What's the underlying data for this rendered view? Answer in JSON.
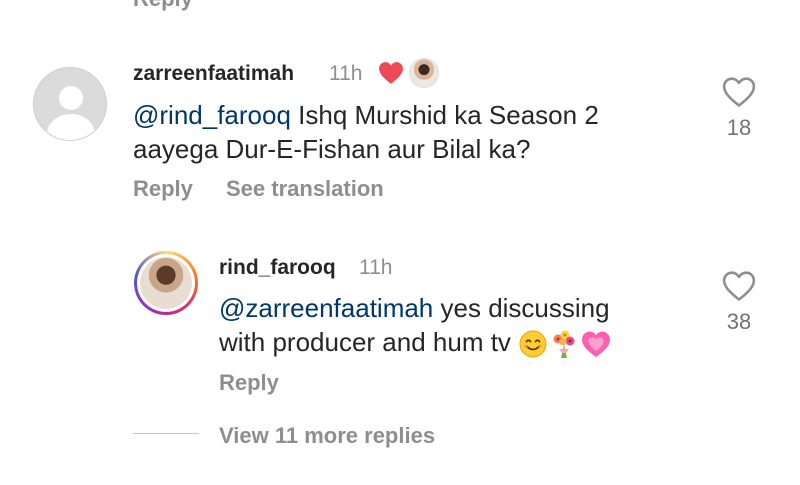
{
  "previous": {
    "reply_label": "Reply"
  },
  "comment": {
    "username": "zarreenfaatimah",
    "time": "11h",
    "mention": "@rind_farooq",
    "text_line1": " Ishq Murshid ka Season 2",
    "text_line2": "aayega Dur-E-Fishan aur Bilal ka?",
    "reply_label": "Reply",
    "translate_label": "See translation",
    "like_count": "18",
    "author_liked": true,
    "heart_color": "#ed4956"
  },
  "reply": {
    "username": "rind_farooq",
    "time": "11h",
    "mention": "@zarreenfaatimah",
    "text_line1": " yes discussing",
    "text_line2": "with producer and hum tv",
    "emojis": [
      "smiling-face-icon",
      "bouquet-icon",
      "growing-heart-icon"
    ],
    "reply_label": "Reply",
    "like_count": "38"
  },
  "thread": {
    "more_replies_label": "View 11 more replies"
  },
  "colors": {
    "text": "#262626",
    "muted": "#8e8e8e",
    "mention": "#00376b",
    "like_red": "#ed4956"
  }
}
